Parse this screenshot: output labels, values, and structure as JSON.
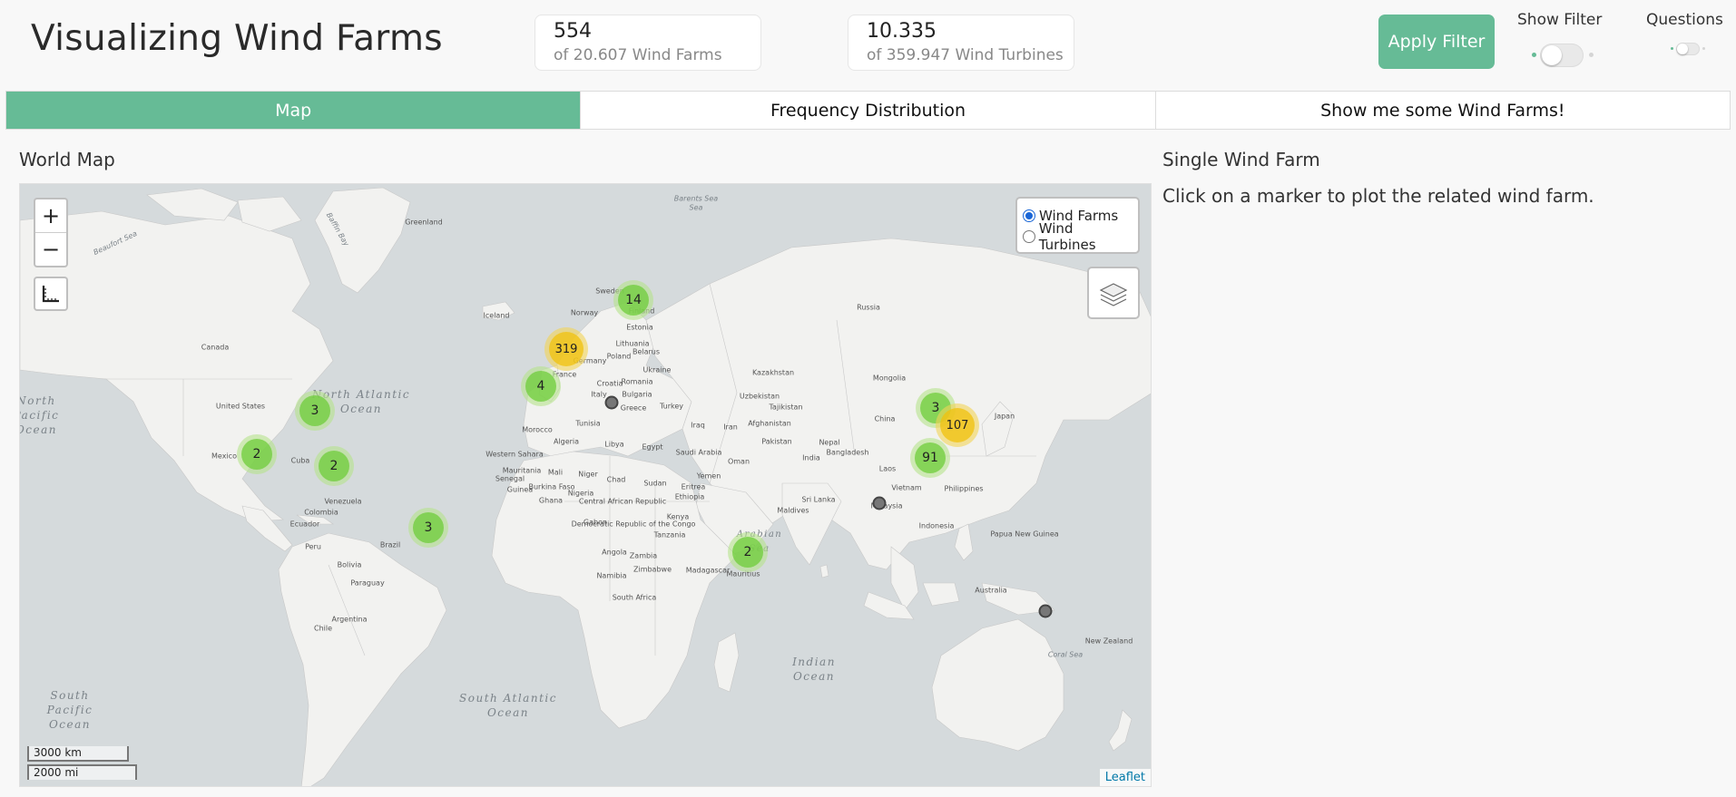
{
  "header": {
    "title": "Visualizing Wind Farms",
    "stats": [
      {
        "value": "554",
        "caption": "of 20.607 Wind Farms"
      },
      {
        "value": "10.335",
        "caption": "of 359.947 Wind Turbines"
      }
    ],
    "apply_label": "Apply Filter",
    "show_filter_label": "Show Filter",
    "questions_label": "Questions",
    "accent_color": "#66bb96"
  },
  "tabs": [
    {
      "label": "Map",
      "active": true
    },
    {
      "label": "Frequency Distribution",
      "active": false
    },
    {
      "label": "Show me some Wind Farms!",
      "active": false
    }
  ],
  "map_section": {
    "title": "World Map",
    "layer_options": [
      {
        "label": "Wind Farms",
        "selected": true
      },
      {
        "label": "Wind Turbines",
        "selected": false
      }
    ],
    "zoom_in": "+",
    "zoom_out": "−",
    "scale_km": "3000 km",
    "scale_mi": "2000 mi",
    "attribution": "Leaflet",
    "clusters": [
      "14",
      "319",
      "4",
      "3",
      "2",
      "2",
      "3",
      "3",
      "107",
      "91",
      "2"
    ],
    "country_labels": [
      "Greenland",
      "Iceland",
      "Canada",
      "United States",
      "Mexico",
      "Cuba",
      "Venezuela",
      "Colombia",
      "Ecuador",
      "Peru",
      "Brazil",
      "Bolivia",
      "Paraguay",
      "Chile",
      "Argentina",
      "Sweden",
      "Norway",
      "Finland",
      "Estonia",
      "Lithuania",
      "Belarus",
      "Poland",
      "Germany",
      "Ukraine",
      "Romania",
      "France",
      "Italy",
      "Croatia",
      "Bulgaria",
      "Greece",
      "Turkey",
      "Russia",
      "Kazakhstan",
      "Mongolia",
      "Uzbekistan",
      "Tajikistan",
      "Afghanistan",
      "Iran",
      "Iraq",
      "Saudi Arabia",
      "Oman",
      "Pakistan",
      "India",
      "Nepal",
      "Bangladesh",
      "China",
      "Japan",
      "Laos",
      "Vietnam",
      "Philippines",
      "Malaysia",
      "Sri Lanka",
      "Indonesia",
      "Papua New Guinea",
      "Australia",
      "New Zealand",
      "Maldives",
      "Morocco",
      "Algeria",
      "Libya",
      "Egypt",
      "Tunisia",
      "Western Sahara",
      "Mauritania",
      "Mali",
      "Niger",
      "Chad",
      "Sudan",
      "Eritrea",
      "Ethiopia",
      "Senegal",
      "Burkina Faso",
      "Guinea",
      "Ghana",
      "Nigeria",
      "Central African Republic",
      "Gabon",
      "Democratic Republic of the Congo",
      "Kenya",
      "Tanzania",
      "Angola",
      "Zambia",
      "Zimbabwe",
      "Namibia",
      "South Africa",
      "Madagascar",
      "Mauritius",
      "Yemen",
      "Barents Sea",
      "Coral Sea",
      "Baffin Bay",
      "Beaufort Sea",
      "Sea"
    ],
    "ocean_labels": [
      "North Atlantic Ocean",
      "South Atlantic Ocean",
      "Indian Ocean",
      "Arabian Sea",
      "South Pacific Ocean",
      "North Pacific Ocean"
    ]
  },
  "detail_section": {
    "title": "Single Wind Farm",
    "hint": "Click on a marker to plot the related wind farm."
  }
}
